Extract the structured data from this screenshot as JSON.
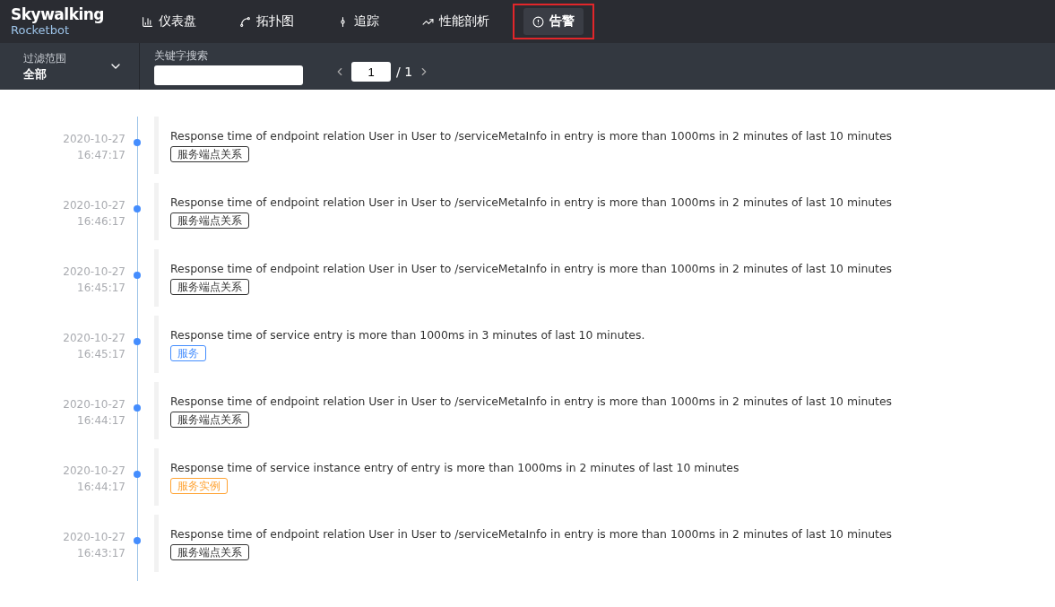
{
  "logo": {
    "name": "Skywalking",
    "subtitle": "Rocketbot"
  },
  "nav": [
    {
      "label": "仪表盘",
      "selected": false
    },
    {
      "label": "拓扑图",
      "selected": false
    },
    {
      "label": "追踪",
      "selected": false
    },
    {
      "label": "性能剖析",
      "selected": false
    },
    {
      "label": "告警",
      "selected": true
    }
  ],
  "filter": {
    "label": "过滤范围",
    "value": "全部"
  },
  "search": {
    "label": "关键字搜索"
  },
  "pager": {
    "page": "1",
    "total": "/ 1"
  },
  "alarms": [
    {
      "date": "2020-10-27",
      "time": "16:47:17",
      "message": "Response time of endpoint relation User in User to /serviceMetaInfo in entry is more than 1000ms in 2 minutes of last 10 minutes",
      "tag": "服务端点关系",
      "color": "#333333"
    },
    {
      "date": "2020-10-27",
      "time": "16:46:17",
      "message": "Response time of endpoint relation User in User to /serviceMetaInfo in entry is more than 1000ms in 2 minutes of last 10 minutes",
      "tag": "服务端点关系",
      "color": "#333333"
    },
    {
      "date": "2020-10-27",
      "time": "16:45:17",
      "message": "Response time of endpoint relation User in User to /serviceMetaInfo in entry is more than 1000ms in 2 minutes of last 10 minutes",
      "tag": "服务端点关系",
      "color": "#333333"
    },
    {
      "date": "2020-10-27",
      "time": "16:45:17",
      "message": "Response time of service entry is more than 1000ms in 3 minutes of last 10 minutes.",
      "tag": "服务",
      "color": "#448dfe"
    },
    {
      "date": "2020-10-27",
      "time": "16:44:17",
      "message": "Response time of endpoint relation User in User to /serviceMetaInfo in entry is more than 1000ms in 2 minutes of last 10 minutes",
      "tag": "服务端点关系",
      "color": "#333333"
    },
    {
      "date": "2020-10-27",
      "time": "16:44:17",
      "message": "Response time of service instance entry of entry is more than 1000ms in 2 minutes of last 10 minutes",
      "tag": "服务实例",
      "color": "#ffa333"
    },
    {
      "date": "2020-10-27",
      "time": "16:43:17",
      "message": "Response time of endpoint relation User in User to /serviceMetaInfo in entry is more than 1000ms in 2 minutes of last 10 minutes",
      "tag": "服务端点关系",
      "color": "#333333"
    }
  ]
}
